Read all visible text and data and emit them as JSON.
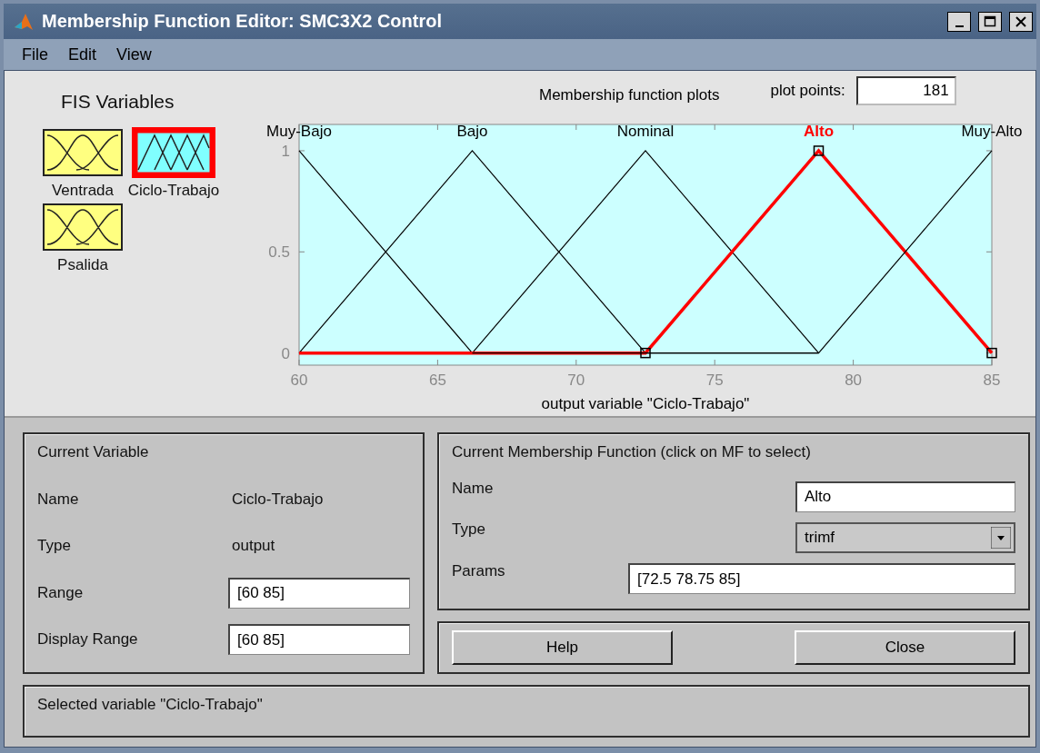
{
  "window": {
    "title": "Membership Function Editor: SMC3X2 Control"
  },
  "menu": [
    "File",
    "Edit",
    "View"
  ],
  "fis_variables": {
    "title": "FIS Variables",
    "items": [
      {
        "name": "Ventrada",
        "kind": "input",
        "selected": false
      },
      {
        "name": "Ciclo-Trabajo",
        "kind": "output",
        "selected": true
      },
      {
        "name": "Psalida",
        "kind": "input",
        "selected": false
      }
    ]
  },
  "plot": {
    "title": "Membership function plots",
    "plot_points_label": "plot points:",
    "plot_points": "181",
    "membership_functions": [
      {
        "label": "Muy-Bajo",
        "selected": false
      },
      {
        "label": "Bajo",
        "selected": false
      },
      {
        "label": "Nominal",
        "selected": false
      },
      {
        "label": "Alto",
        "selected": true
      },
      {
        "label": "Muy-Alto",
        "selected": false
      }
    ],
    "chart_data": {
      "type": "line",
      "xlabel": "output variable \"Ciclo-Trabajo\"",
      "x": [
        60,
        66.25,
        72.5,
        78.75,
        85
      ],
      "xlim": [
        60,
        85
      ],
      "ylim": [
        -0.06,
        1.13
      ],
      "xticks": [
        60,
        65,
        70,
        75,
        80,
        85
      ],
      "yticks": [
        0,
        0.5,
        1
      ],
      "series": [
        {
          "color": "#000000",
          "values": [
            1,
            0,
            0,
            0,
            null
          ]
        },
        {
          "color": "#000000",
          "values": [
            0,
            1,
            0,
            null,
            null
          ]
        },
        {
          "color": "#000000",
          "values": [
            null,
            0,
            1,
            0,
            null
          ]
        },
        {
          "color": "#ff0000",
          "values": [
            0,
            0,
            0,
            1,
            0
          ]
        },
        {
          "color": "#000000",
          "values": [
            null,
            0,
            0,
            0,
            1
          ]
        }
      ]
    }
  },
  "current_variable": {
    "title": "Current Variable",
    "fields": [
      {
        "label": "Name",
        "value": "Ciclo-Trabajo",
        "kind": "text"
      },
      {
        "label": "Type",
        "value": "output",
        "kind": "text"
      },
      {
        "label": "Range",
        "value": "[60 85]",
        "kind": "input"
      },
      {
        "label": "Display Range",
        "value": "[60 85]",
        "kind": "input"
      }
    ]
  },
  "current_mf": {
    "title": "Current Membership Function (click on MF to select)",
    "fields": [
      {
        "label": "Name",
        "value": "Alto",
        "kind": "input"
      },
      {
        "label": "Type",
        "value": "trimf",
        "kind": "dropdown"
      },
      {
        "label": "Params",
        "value": "[72.5 78.75 85]",
        "kind": "wide-input"
      }
    ]
  },
  "buttons": [
    "Help",
    "Close"
  ],
  "status": "Selected variable \"Ciclo-Trabajo\""
}
